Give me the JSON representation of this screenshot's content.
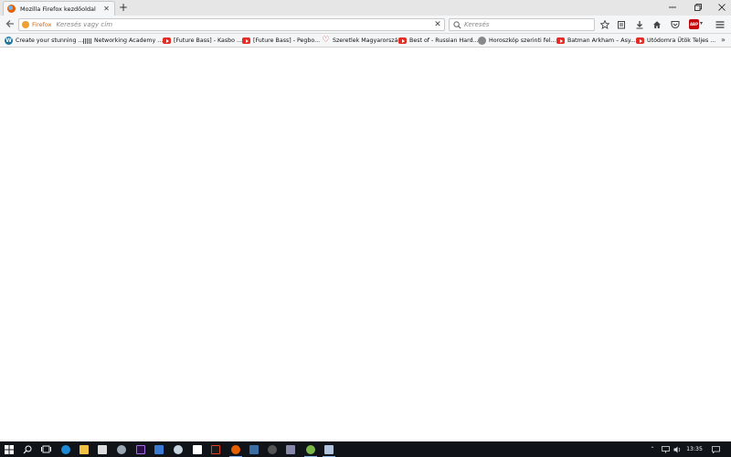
{
  "tab": {
    "title": "Mozilla Firefox kezdőoldal",
    "favicon": "firefox-icon"
  },
  "window_controls": [
    "minimize-icon",
    "maximize-icon",
    "close-icon"
  ],
  "navbar": {
    "identity_label": "Firefox",
    "url_placeholder": "Keresés vagy cím",
    "search_placeholder": "Keresés",
    "icons": [
      "bookmark-star-icon",
      "reading-list-icon",
      "downloads-icon",
      "home-icon",
      "pocket-icon",
      "adblock-plus-icon",
      "menu-icon"
    ]
  },
  "bookmarks": [
    {
      "label": "Create your stunning ...",
      "icon": "wordpress-icon"
    },
    {
      "label": "Networking Academy ...",
      "icon": "netacad-icon"
    },
    {
      "label": "[Future Bass] - Kasbo ...",
      "icon": "youtube-icon"
    },
    {
      "label": "[Future Bass] - Pegbo...",
      "icon": "youtube-icon"
    },
    {
      "label": "Szeretlek Magyarország",
      "icon": "heart-icon"
    },
    {
      "label": "Best of - Russian Hard...",
      "icon": "youtube-icon"
    },
    {
      "label": "Horoszkóp szerinti fel...",
      "icon": "globe-icon"
    },
    {
      "label": "Batman Arkham – Asy...",
      "icon": "youtube-icon"
    },
    {
      "label": "Utódomra Ütök Teljes ...",
      "icon": "youtube-icon"
    }
  ],
  "taskbar": {
    "clock": "13:35",
    "apps": [
      "start",
      "search",
      "task-view",
      "edge",
      "file-explorer",
      "store",
      "steam-like",
      "adobe",
      "app",
      "steam",
      "app",
      "app-red",
      "firefox",
      "app",
      "app",
      "app",
      "app",
      "app"
    ]
  },
  "colors": {
    "taskbar": "#101418",
    "tabstrip": "#e6e6e6",
    "toolbar": "#f5f6f7",
    "accent": "#e66000"
  }
}
